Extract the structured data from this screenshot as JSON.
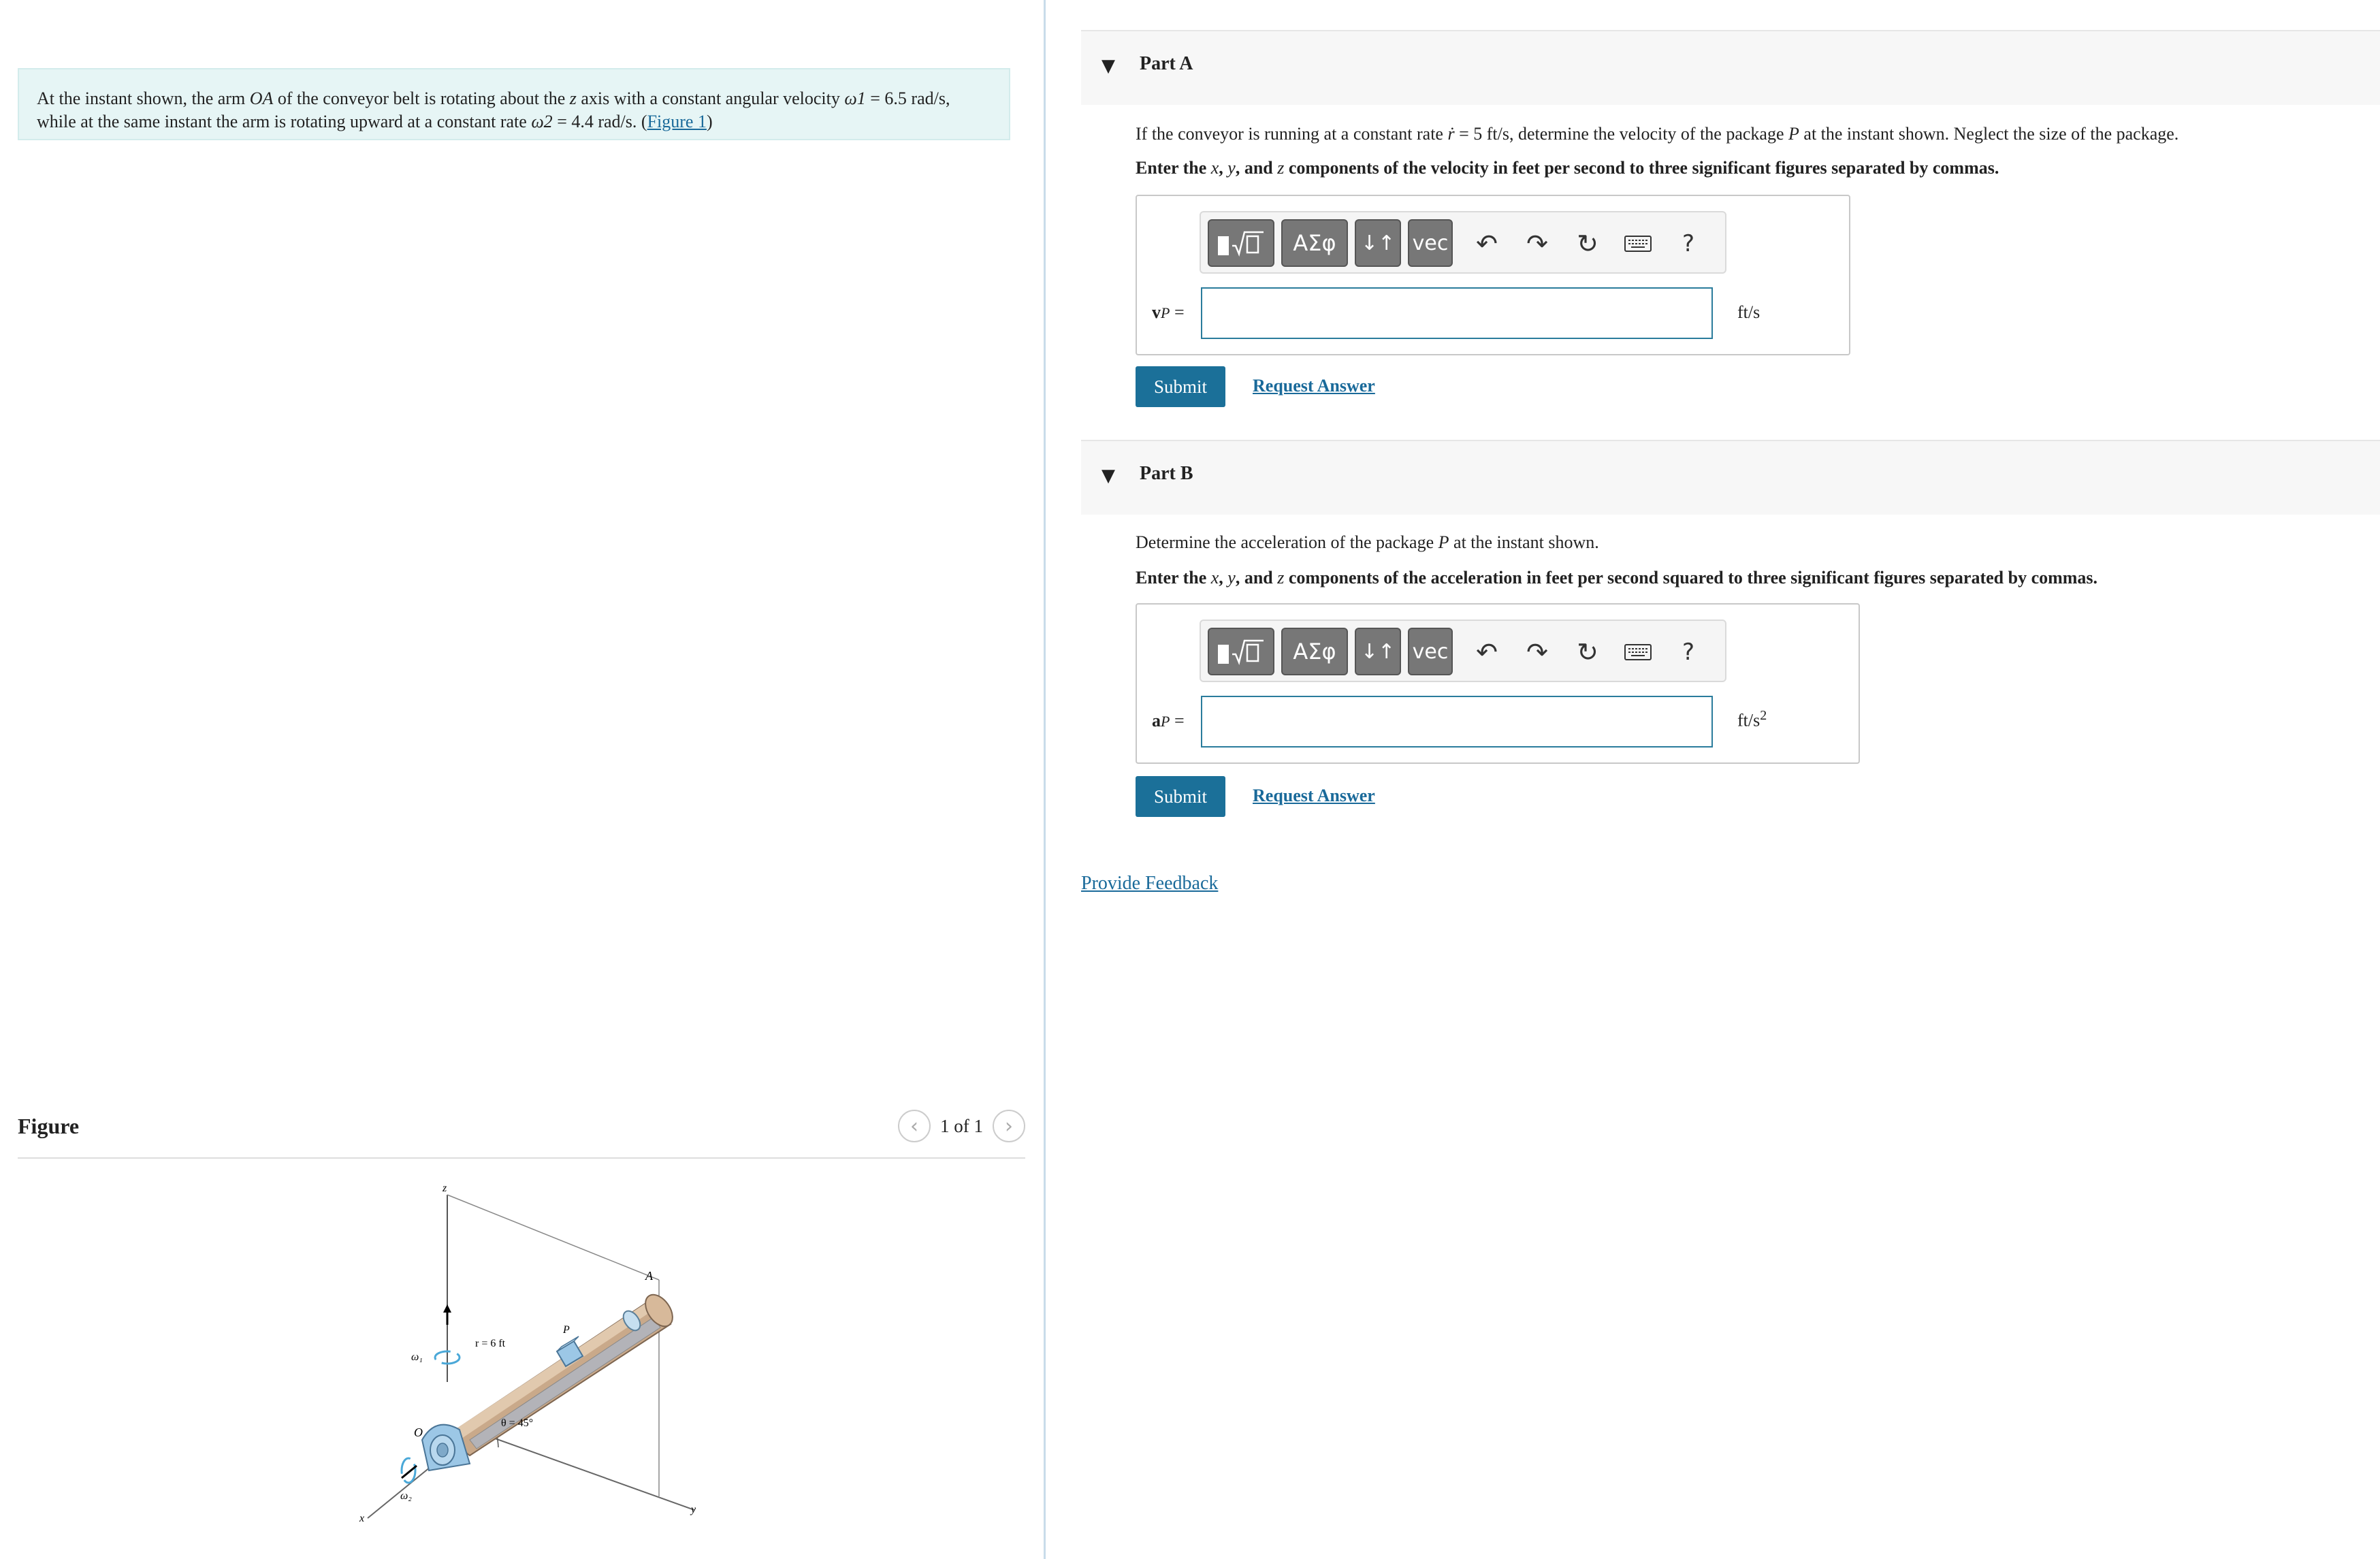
{
  "problem": {
    "t1": "At the instant shown, the arm ",
    "oa": "OA",
    "t2": " of the conveyor belt is rotating about the ",
    "zvar": "z",
    "t3": " axis with a constant angular velocity ",
    "omega1": "ω1",
    "t4": " = 6.5 rad/s, while at the same instant the arm is rotating upward at a constant rate ",
    "omega2": "ω2",
    "t5": " = 4.4 rad/s. (",
    "figure_link": "Figure 1",
    "t6": ")"
  },
  "figure_panel": {
    "title": "Figure",
    "pager": "1 of 1",
    "labels": {
      "z": "z",
      "x": "x",
      "y": "y",
      "o": "O",
      "a": "A",
      "p": "P",
      "r": "r = 6 ft",
      "theta": "θ = 45°",
      "w1": "ω₁",
      "w2": "ω₂"
    }
  },
  "part_a": {
    "label": "Part A",
    "prompt_1": "If the conveyor is running at a constant rate ",
    "rdot": "ṙ",
    "prompt_2": " = 5 ft/s, determine the velocity of the package ",
    "p": "P",
    "prompt_3": " at the instant shown. Neglect the size of the package.",
    "instr_1": "Enter the ",
    "x": "x",
    "sep1": ", ",
    "y": "y",
    "sep2": ", and ",
    "z": "z",
    "instr_2": " components of the velocity in feet per second to three significant figures separated by commas.",
    "ans_bold": "v",
    "ans_sub": "P",
    "ans_eq": " =",
    "unit": "ft/s",
    "submit": "Submit",
    "request": "Request Answer"
  },
  "part_b": {
    "label": "Part B",
    "prompt_1": "Determine the acceleration of the package ",
    "p": "P",
    "prompt_2": " at the instant shown.",
    "instr_1": "Enter the ",
    "x": "x",
    "sep1": ", ",
    "y": "y",
    "sep2": ", and ",
    "z": "z",
    "instr_2": " components of the acceleration in feet per second squared to three significant figures separated by commas.",
    "ans_bold": "a",
    "ans_sub": "P",
    "ans_eq": " =",
    "unit": "ft/s",
    "unit_sup": "2",
    "submit": "Submit",
    "request": "Request Answer"
  },
  "toolbar": {
    "greek": "ΑΣφ",
    "arrows": "↓↑",
    "vec": "vec",
    "help": "?"
  },
  "feedback": "Provide Feedback"
}
